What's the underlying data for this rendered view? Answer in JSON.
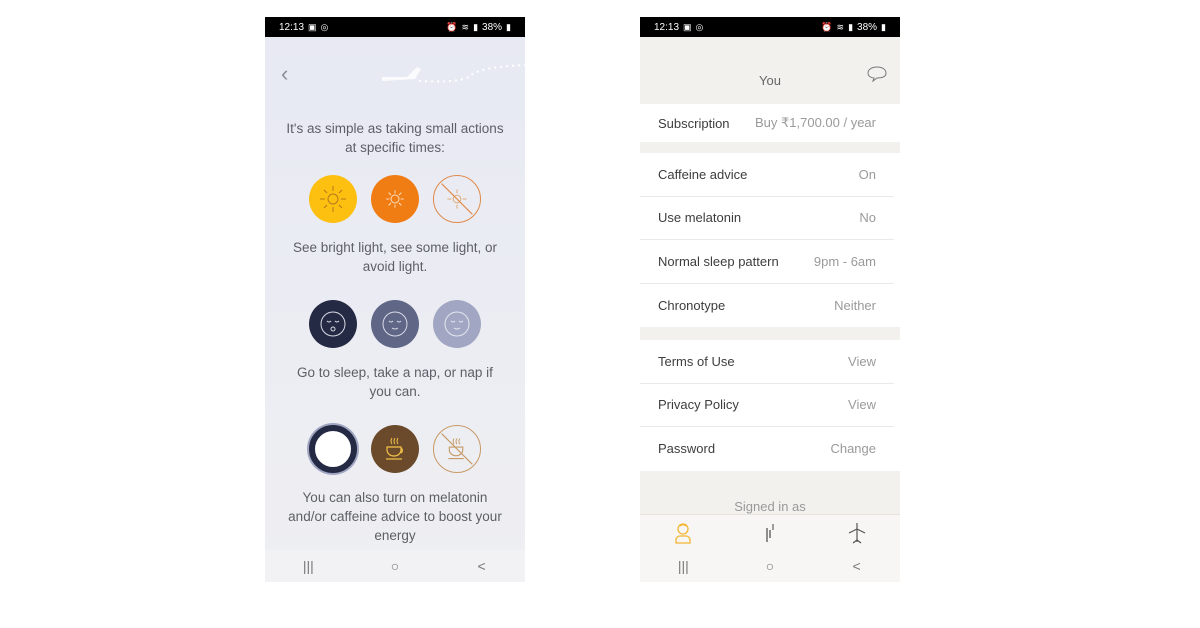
{
  "left_screen": {
    "status": {
      "time": "12:13",
      "battery": "38%"
    },
    "intro_text": "It's as simple as taking small actions at specific times:",
    "light_caption": "See bright light, see some light, or avoid light.",
    "sleep_caption": "Go to sleep, take a nap, or nap if you can.",
    "supplement_caption": "You can also turn on melatonin and/or caffeine advice to boost your energy",
    "light_icons": [
      {
        "name": "bright-light",
        "color": "#fdbf10"
      },
      {
        "name": "some-light",
        "color": "#f07d14"
      },
      {
        "name": "avoid-light",
        "color": "#e08a4a"
      }
    ],
    "sleep_icons": [
      {
        "name": "sleep",
        "color": "#252a44"
      },
      {
        "name": "nap",
        "color": "#5f6686"
      },
      {
        "name": "nap-if-you-can",
        "color": "#a1a7c2"
      }
    ],
    "supplement_icons": [
      {
        "name": "melatonin",
        "color": "#252a44"
      },
      {
        "name": "caffeine",
        "color": "#6b4a2b"
      },
      {
        "name": "avoid-caffeine",
        "color": "#c79a66"
      }
    ]
  },
  "right_screen": {
    "status": {
      "time": "12:13",
      "battery": "38%"
    },
    "title": "You",
    "subscription": {
      "label": "Subscription",
      "value": "Buy ₹1,700.00 / year"
    },
    "settings": [
      {
        "label": "Caffeine advice",
        "value": "On"
      },
      {
        "label": "Use melatonin",
        "value": "No"
      },
      {
        "label": "Normal sleep pattern",
        "value": "9pm - 6am"
      },
      {
        "label": "Chronotype",
        "value": "Neither"
      }
    ],
    "account": [
      {
        "label": "Terms of Use",
        "value": "View"
      },
      {
        "label": "Privacy Policy",
        "value": "View"
      },
      {
        "label": "Password",
        "value": "Change"
      }
    ],
    "signed_in_text": "Signed in as",
    "tabs": [
      {
        "name": "you",
        "active": true,
        "color": "#f2b632"
      },
      {
        "name": "plan",
        "active": false,
        "color": "#555555"
      },
      {
        "name": "trips",
        "active": false,
        "color": "#555555"
      }
    ]
  },
  "system_nav": {
    "recents": "|||",
    "home": "○",
    "back": "<"
  }
}
